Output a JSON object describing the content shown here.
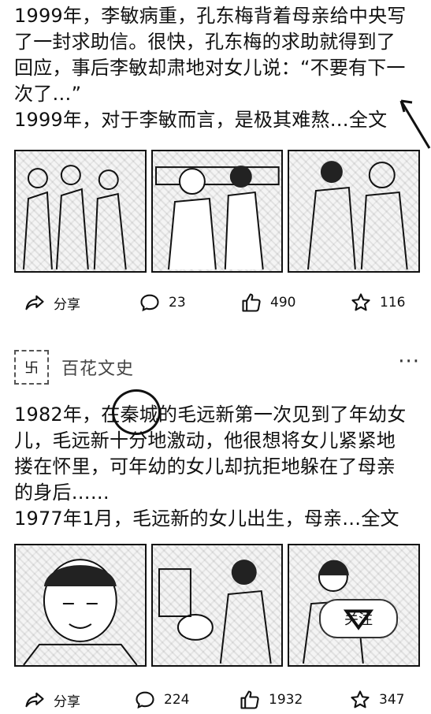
{
  "post1": {
    "text_lines": [
      "1999年，李敏病重，孔东梅背着母亲给中央写",
      "了一封求助信。很快，孔东梅的求助就得到了",
      "回应，事后李敏却肃地对女儿说：“不要有下一",
      "次了…”"
    ],
    "summary": "1999年，对于李敏而言，是极其难熬…",
    "full_text_link": "全文",
    "actions": {
      "share": "分享",
      "comments": "23",
      "likes": "490",
      "favorites": "116"
    }
  },
  "post2": {
    "author": "百花文史",
    "author_avatar_glyph": "卐",
    "more": "···",
    "text_lines": [
      "1982年，在秦城的毛远新第一次见到了年幼女",
      "儿，毛远新十分地激动，他很想将女儿紧紧地",
      "搂在怀里，可年幼的女儿却抗拒地躲在了母亲",
      "的身后……"
    ],
    "summary": "1977年1月，毛远新的女儿出生，母亲…",
    "full_text_link": "全文",
    "follow_badge": "关注",
    "actions": {
      "share": "分享",
      "comments": "224",
      "likes": "1932",
      "favorites": "347"
    }
  }
}
